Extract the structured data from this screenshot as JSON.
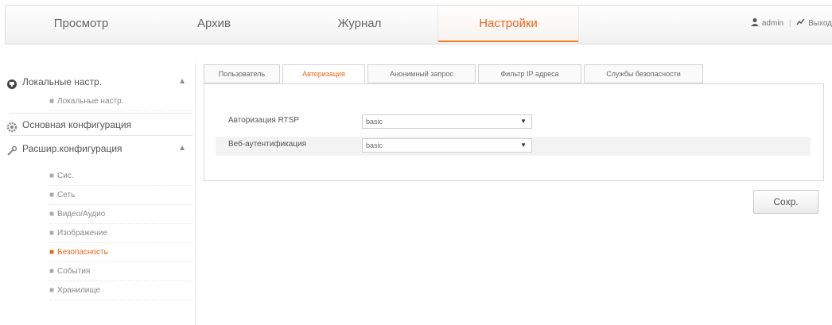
{
  "nav": {
    "items": [
      {
        "label": "Просмотр",
        "active": false
      },
      {
        "label": "Архив",
        "active": false
      },
      {
        "label": "Журнал",
        "active": false
      },
      {
        "label": "Настройки",
        "active": true
      }
    ],
    "user_name": "admin",
    "logout_label": "Выход"
  },
  "sidebar": {
    "local_group": {
      "label": "Локальные настр.",
      "icon": "monitor-icon",
      "expanded": true
    },
    "local_items": [
      "Локальные настр."
    ],
    "basic_group": {
      "label": "Основная конфигурация",
      "icon": "gear-icon"
    },
    "advanced_group": {
      "label": "Расшир.конфигурация",
      "icon": "wrench-icon",
      "expanded": true
    },
    "advanced_items": [
      {
        "label": "Сис.",
        "active": false
      },
      {
        "label": "Сеть",
        "active": false
      },
      {
        "label": "Видео/Аудио",
        "active": false
      },
      {
        "label": "Изображение",
        "active": false
      },
      {
        "label": "Безопасность",
        "active": true
      },
      {
        "label": "События",
        "active": false
      },
      {
        "label": "Хранилище",
        "active": false
      }
    ]
  },
  "tabs": [
    {
      "label": "Пользователь",
      "active": false
    },
    {
      "label": "Авторизация",
      "active": true
    },
    {
      "label": "Анонимный запрос",
      "active": false
    },
    {
      "label": "Фильтр IP адреса",
      "active": false
    },
    {
      "label": "Службы безопасности",
      "active": false
    }
  ],
  "form": {
    "rows": [
      {
        "label": "Авторизация RTSP",
        "value": "basic"
      },
      {
        "label": "Веб-аутентификация",
        "value": "basic"
      }
    ]
  },
  "save_label": "Сохр.",
  "colors": {
    "accent": "#e8661a"
  }
}
